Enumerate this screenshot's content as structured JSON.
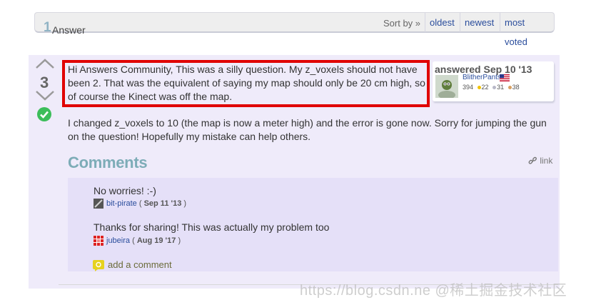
{
  "header": {
    "answer_count": "1",
    "answer_label": "Answer",
    "sort_by_label": "Sort by »",
    "sort_tabs": [
      "oldest",
      "newest",
      "most voted"
    ]
  },
  "answer": {
    "vote_count": "3",
    "accepted": true,
    "paragraphs": [
      "Hi Answers Community, This was a silly question. My z_voxels should not have been 2. That was the equivalent of saying my map should only be 20 cm high, so of course the Kinect was off the map.",
      "I changed z_voxels to 10 (the map is now a meter high) and the error is gone now. Sorry for jumping the gun on the question! Hopefully my mistake can help others."
    ],
    "user_card": {
      "answered_label": "answered Sep 10 '13",
      "username": "BlitherPants",
      "karma": "394",
      "gold": "22",
      "silver": "31",
      "bronze": "38"
    }
  },
  "comments": {
    "heading": "Comments",
    "link_label": "link",
    "items": [
      {
        "text": "No worries! :-)",
        "author": "bit-pirate",
        "date": "Sep 11 '13"
      },
      {
        "text": "Thanks for sharing! This was actually my problem too",
        "author": "jubeira",
        "date": "Aug 19 '17"
      }
    ],
    "add_comment_label": "add a comment"
  },
  "watermark": "https://blog.csdn.ne @稀土掘金技术社区",
  "colors": {
    "link": "#2a4d9c",
    "highlight_border": "#e00000",
    "answer_bg": "#efebfa",
    "comments_bg": "#e5e0f8",
    "accepted_green": "#3cbd5a",
    "comments_heading": "#7dacb7"
  }
}
